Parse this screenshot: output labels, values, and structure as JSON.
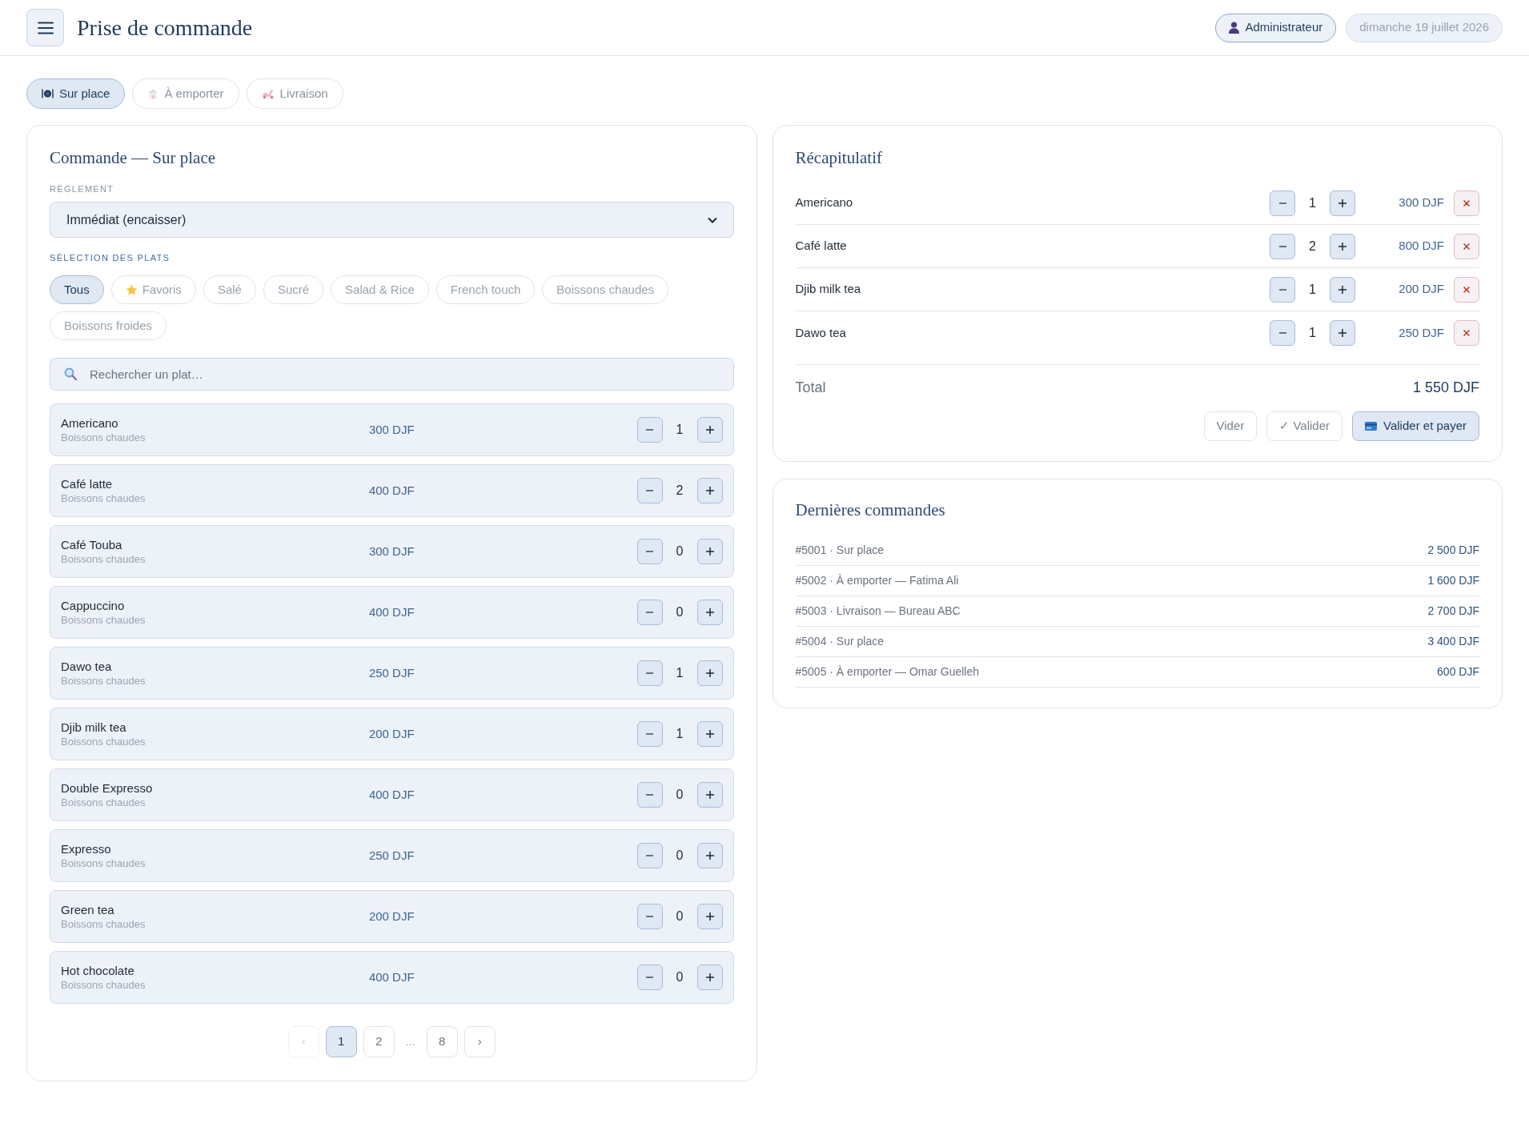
{
  "header": {
    "title": "Prise de commande",
    "user": "Administrateur",
    "date": "dimanche 19 juillet 2026"
  },
  "order_types": [
    {
      "kind": "dine_in",
      "label": "Sur place",
      "selected": true
    },
    {
      "kind": "takeaway",
      "label": "À emporter",
      "selected": false
    },
    {
      "kind": "delivery",
      "label": "Livraison",
      "selected": false
    }
  ],
  "order_panel": {
    "title": "Commande — Sur place",
    "payment": {
      "label": "RÈGLEMENT",
      "value": "Immédiat (encaisser)"
    },
    "selection_label": "SÉLECTION DES PLATS",
    "categories": [
      {
        "kind": "plain",
        "label": "Tous",
        "selected": true
      },
      {
        "kind": "favorites",
        "label": "Favoris",
        "selected": false
      },
      {
        "kind": "plain",
        "label": "Salé",
        "selected": false
      },
      {
        "kind": "plain",
        "label": "Sucré",
        "selected": false
      },
      {
        "kind": "plain",
        "label": "Salad & Rice",
        "selected": false
      },
      {
        "kind": "plain",
        "label": "French touch",
        "selected": false
      },
      {
        "kind": "plain",
        "label": "Boissons chaudes",
        "selected": false
      },
      {
        "kind": "plain",
        "label": "Boissons froides",
        "selected": false
      }
    ],
    "search": {
      "placeholder": "Rechercher un plat…"
    },
    "dishes": [
      {
        "name": "Americano",
        "category": "Boissons chaudes",
        "price": "300 DJF",
        "quantity": "1"
      },
      {
        "name": "Café latte",
        "category": "Boissons chaudes",
        "price": "400 DJF",
        "quantity": "2"
      },
      {
        "name": "Café Touba",
        "category": "Boissons chaudes",
        "price": "300 DJF",
        "quantity": "0"
      },
      {
        "name": "Cappuccino",
        "category": "Boissons chaudes",
        "price": "400 DJF",
        "quantity": "0"
      },
      {
        "name": "Dawo tea",
        "category": "Boissons chaudes",
        "price": "250 DJF",
        "quantity": "1"
      },
      {
        "name": "Djib milk tea",
        "category": "Boissons chaudes",
        "price": "200 DJF",
        "quantity": "1"
      },
      {
        "name": "Double Expresso",
        "category": "Boissons chaudes",
        "price": "400 DJF",
        "quantity": "0"
      },
      {
        "name": "Expresso",
        "category": "Boissons chaudes",
        "price": "250 DJF",
        "quantity": "0"
      },
      {
        "name": "Green tea",
        "category": "Boissons chaudes",
        "price": "200 DJF",
        "quantity": "0"
      },
      {
        "name": "Hot chocolate",
        "category": "Boissons chaudes",
        "price": "400 DJF",
        "quantity": "0"
      }
    ],
    "pagination": {
      "prev": {
        "label": "‹",
        "disabled": true
      },
      "pages": [
        {
          "kind": "page",
          "label": "1",
          "selected": true
        },
        {
          "kind": "page",
          "label": "2",
          "selected": false
        },
        {
          "kind": "gap",
          "label": "…"
        },
        {
          "kind": "page",
          "label": "8",
          "selected": false
        }
      ],
      "next": {
        "label": "›",
        "disabled": false
      }
    }
  },
  "summary": {
    "title": "Récapitulatif",
    "lines": [
      {
        "name": "Americano",
        "quantity": "1",
        "amount": "300 DJF"
      },
      {
        "name": "Café latte",
        "quantity": "2",
        "amount": "800 DJF"
      },
      {
        "name": "Djib milk tea",
        "quantity": "1",
        "amount": "200 DJF"
      },
      {
        "name": "Dawo tea",
        "quantity": "1",
        "amount": "250 DJF"
      }
    ],
    "total": {
      "label": "Total",
      "value": "1 550 DJF"
    },
    "actions": [
      {
        "kind": "outline",
        "label": "Vider"
      },
      {
        "kind": "outline",
        "label": "✓ Valider"
      },
      {
        "kind": "primary",
        "label": "Valider et payer"
      }
    ]
  },
  "recent_orders": {
    "title": "Dernières commandes",
    "orders": [
      {
        "label": "#5001 · Sur place",
        "amount": "2 500 DJF"
      },
      {
        "label": "#5002 · À emporter — Fatima Ali",
        "amount": "1 600 DJF"
      },
      {
        "label": "#5003 · Livraison — Bureau ABC",
        "amount": "2 700 DJF"
      },
      {
        "label": "#5004 · Sur place",
        "amount": "3 400 DJF"
      },
      {
        "label": "#5005 · À emporter — Omar Guelleh",
        "amount": "600 DJF"
      }
    ]
  }
}
